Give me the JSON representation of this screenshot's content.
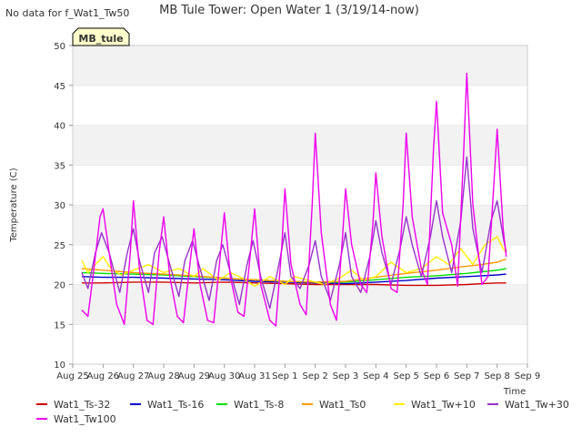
{
  "chart_data": {
    "type": "line",
    "title": "MB Tule Tower: Open Water 1 (3/19/14-now)",
    "corner_note": "No data for f_Wat1_Tw50",
    "badge": "MB_tule",
    "xlabel": "Time",
    "ylabel": "Temperature (C)",
    "ylim": [
      10,
      50
    ],
    "yticks": [
      10,
      15,
      20,
      25,
      30,
      35,
      40,
      45,
      50
    ],
    "xlim": [
      0,
      15
    ],
    "xtick_values": [
      0,
      1,
      2,
      3,
      4,
      5,
      6,
      7,
      8,
      9,
      10,
      11,
      12,
      13,
      14,
      15
    ],
    "xtick_labels": [
      "Aug 25",
      "Aug 26",
      "Aug 27",
      "Aug 28",
      "Aug 29",
      "Aug 30",
      "Aug 31",
      "Sep 1",
      "Sep 2",
      "Sep 3",
      "Sep 4",
      "Sep 5",
      "Sep 6",
      "Sep 7",
      "Sep 8",
      "Sep 9"
    ],
    "grid": "horizontal bands",
    "legend_position": "bottom",
    "series": [
      {
        "name": "Wat1_Ts-32",
        "color": "#cc0000",
        "x": [
          0.3,
          1,
          2,
          3,
          4,
          5,
          6,
          7,
          8,
          9,
          10,
          11,
          12,
          13,
          13.5,
          14,
          14.3
        ],
        "y": [
          20.2,
          20.2,
          20.3,
          20.3,
          20.2,
          20.3,
          20.2,
          20.1,
          20.0,
          20.0,
          20.0,
          19.9,
          19.9,
          20.0,
          20.1,
          20.2,
          20.2
        ]
      },
      {
        "name": "Wat1_Ts-16",
        "color": "#0000cc",
        "x": [
          0.3,
          1,
          2,
          3,
          4,
          5,
          6,
          7,
          8,
          9,
          10,
          11,
          12,
          13,
          13.5,
          14,
          14.3
        ],
        "y": [
          21.0,
          20.9,
          20.9,
          20.8,
          20.7,
          20.6,
          20.4,
          20.3,
          20.2,
          20.1,
          20.3,
          20.5,
          20.8,
          21.0,
          21.1,
          21.2,
          21.3
        ]
      },
      {
        "name": "Wat1_Ts-8",
        "color": "#00dd00",
        "x": [
          0.3,
          1,
          2,
          3,
          4,
          5,
          6,
          7,
          8,
          9,
          10,
          11,
          12,
          13,
          13.5,
          14,
          14.3
        ],
        "y": [
          21.5,
          21.4,
          21.3,
          21.2,
          21.0,
          20.8,
          20.6,
          20.4,
          20.3,
          20.3,
          20.6,
          20.9,
          21.1,
          21.4,
          21.6,
          21.8,
          22.0
        ]
      },
      {
        "name": "Wat1_Ts0",
        "color": "#ff9900",
        "x": [
          0.3,
          1,
          2,
          3,
          4,
          5,
          6,
          7,
          8,
          9,
          10,
          11,
          12,
          13,
          13.5,
          14,
          14.3
        ],
        "y": [
          22.0,
          21.8,
          21.5,
          21.3,
          21.1,
          20.8,
          20.6,
          20.4,
          20.3,
          20.4,
          20.9,
          21.4,
          21.8,
          22.3,
          22.5,
          22.8,
          23.2
        ]
      },
      {
        "name": "Wat1_Tw+10",
        "color": "#ffee00",
        "x": [
          0.3,
          0.5,
          1,
          1.3,
          1.6,
          2,
          2.5,
          3,
          3.5,
          4,
          4.3,
          4.8,
          5.2,
          5.6,
          6,
          6.5,
          7,
          7.3,
          7.8,
          8.3,
          8.8,
          9.2,
          9.6,
          10,
          10.5,
          11,
          11.5,
          12,
          12.4,
          12.8,
          13.2,
          13.6,
          14,
          14.2,
          14.3
        ],
        "y": [
          23.0,
          21.5,
          23.5,
          21.8,
          21.2,
          21.8,
          22.5,
          21.5,
          22.0,
          21.0,
          22.0,
          20.5,
          21.5,
          20.8,
          19.8,
          21.0,
          20.0,
          21.0,
          20.5,
          20.0,
          20.8,
          21.8,
          20.5,
          21.0,
          22.8,
          21.5,
          22.0,
          23.5,
          22.5,
          24.5,
          22.5,
          25.0,
          26.0,
          24.5,
          24.0
        ]
      },
      {
        "name": "Wat1_Tw+30",
        "color": "#9933cc",
        "x": [
          0.3,
          0.5,
          0.75,
          0.95,
          1.2,
          1.55,
          1.8,
          2.0,
          2.2,
          2.5,
          2.7,
          2.95,
          3.2,
          3.5,
          3.7,
          3.95,
          4.2,
          4.5,
          4.75,
          4.95,
          5.2,
          5.5,
          5.75,
          5.95,
          6.2,
          6.5,
          6.8,
          7.0,
          7.2,
          7.5,
          7.8,
          8.0,
          8.2,
          8.5,
          8.8,
          9.0,
          9.2,
          9.5,
          9.8,
          10.0,
          10.2,
          10.5,
          10.8,
          11.0,
          11.2,
          11.5,
          11.8,
          12.0,
          12.2,
          12.5,
          12.8,
          13.0,
          13.2,
          13.5,
          13.8,
          14.0,
          14.2,
          14.3
        ],
        "y": [
          21.5,
          19.5,
          24.0,
          26.5,
          24.0,
          19.0,
          24.0,
          27.0,
          23.0,
          19.0,
          24.0,
          26.0,
          22.5,
          18.5,
          23.0,
          25.5,
          22.0,
          18.0,
          23.0,
          25.0,
          21.5,
          17.5,
          22.5,
          25.5,
          21.0,
          17.0,
          22.5,
          26.5,
          21.0,
          19.5,
          22.5,
          25.5,
          21.0,
          18.0,
          22.5,
          26.5,
          21.0,
          19.0,
          23.5,
          28.0,
          24.0,
          20.0,
          24.5,
          28.5,
          25.0,
          21.0,
          26.0,
          30.5,
          26.0,
          21.5,
          28.0,
          36.0,
          27.0,
          21.5,
          28.0,
          30.5,
          26.0,
          24.0
        ]
      },
      {
        "name": "Wat1_Tw100",
        "color": "#ee00ee",
        "x": [
          0.3,
          0.5,
          0.7,
          0.9,
          1.0,
          1.2,
          1.45,
          1.7,
          1.9,
          2.0,
          2.2,
          2.45,
          2.65,
          2.85,
          3.0,
          3.2,
          3.45,
          3.65,
          3.85,
          4.0,
          4.2,
          4.45,
          4.65,
          4.85,
          5.0,
          5.2,
          5.45,
          5.65,
          5.85,
          6.0,
          6.2,
          6.5,
          6.7,
          6.9,
          7.0,
          7.2,
          7.5,
          7.7,
          7.9,
          8.0,
          8.2,
          8.5,
          8.7,
          8.9,
          9.0,
          9.2,
          9.5,
          9.7,
          9.9,
          10.0,
          10.2,
          10.5,
          10.7,
          10.9,
          11.0,
          11.2,
          11.5,
          11.7,
          11.9,
          12.0,
          12.2,
          12.5,
          12.7,
          12.9,
          13.0,
          13.2,
          13.5,
          13.7,
          13.9,
          14.0,
          14.2,
          14.3
        ],
        "y": [
          16.8,
          16.0,
          22.0,
          28.5,
          29.5,
          24.0,
          17.5,
          15.0,
          24.0,
          30.5,
          22.0,
          15.5,
          15.0,
          24.0,
          28.5,
          21.0,
          16.0,
          15.2,
          22.0,
          27.0,
          20.0,
          15.5,
          15.2,
          23.0,
          29.0,
          21.0,
          16.5,
          16.0,
          23.5,
          29.5,
          20.0,
          15.5,
          14.8,
          25.0,
          32.0,
          22.5,
          17.5,
          16.2,
          30.0,
          39.0,
          26.5,
          17.5,
          15.5,
          26.0,
          32.0,
          25.0,
          20.0,
          19.0,
          27.5,
          34.0,
          26.0,
          19.5,
          19.0,
          30.0,
          39.0,
          28.5,
          22.0,
          20.0,
          37.0,
          43.0,
          29.0,
          25.0,
          19.8,
          37.0,
          46.5,
          30.0,
          20.0,
          21.0,
          33.0,
          39.5,
          27.0,
          23.5
        ]
      }
    ]
  }
}
